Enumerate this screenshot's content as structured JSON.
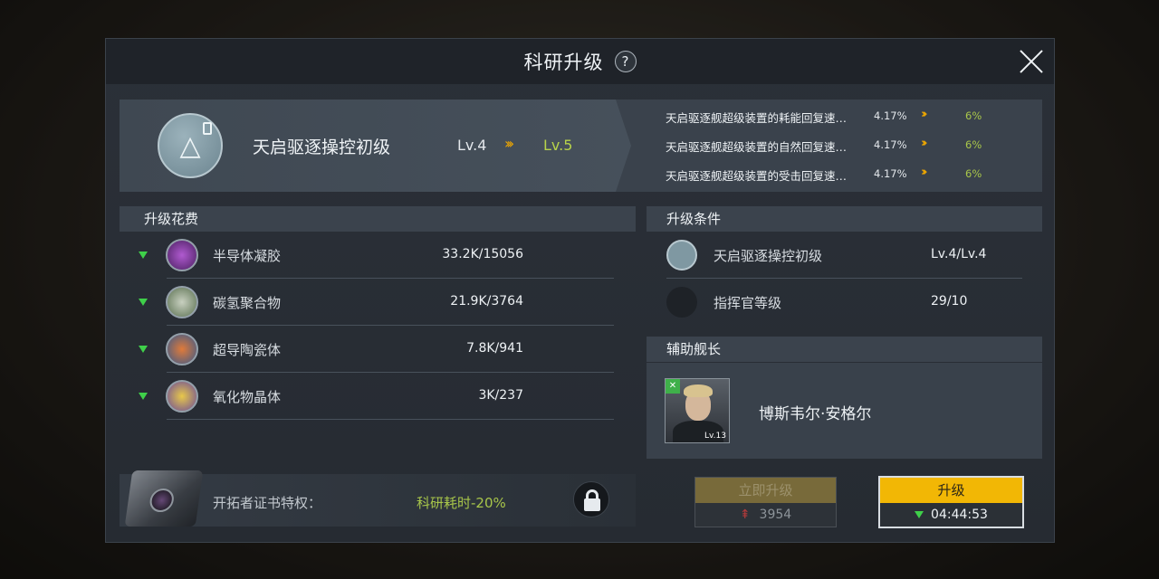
{
  "dialog": {
    "title": "科研升级",
    "help_symbol": "?"
  },
  "tech": {
    "name": "天启驱逐操控初级",
    "level_from": "Lv.4",
    "level_arrow": "›››",
    "level_to": "Lv.5",
    "effects": [
      {
        "name": "天启驱逐舰超级装置的耗能回复速…",
        "from": "4.17%",
        "arrow": "›››",
        "to": "6%"
      },
      {
        "name": "天启驱逐舰超级装置的自然回复速…",
        "from": "4.17%",
        "arrow": "›››",
        "to": "6%"
      },
      {
        "name": "天启驱逐舰超级装置的受击回复速…",
        "from": "4.17%",
        "arrow": "›››",
        "to": "6%"
      }
    ]
  },
  "cost": {
    "header": "升级花费",
    "items": [
      {
        "name": "半导体凝胶",
        "value": "33.2K/15056",
        "icon": "gel-resource-icon",
        "color": "#8a3aa8"
      },
      {
        "name": "碳氢聚合物",
        "value": "21.9K/3764",
        "icon": "polymer-resource-icon",
        "color": "#6f8a5a"
      },
      {
        "name": "超导陶瓷体",
        "value": "7.8K/941",
        "icon": "ceramic-resource-icon",
        "color": "#c0642a"
      },
      {
        "name": "氧化物晶体",
        "value": "3K/237",
        "icon": "crystal-resource-icon",
        "color": "#c8a23a"
      }
    ]
  },
  "conditions": {
    "header": "升级条件",
    "items": [
      {
        "name": "天启驱逐操控初级",
        "value": "Lv.4/Lv.4"
      },
      {
        "name": "指挥官等级",
        "value": "29/10"
      }
    ]
  },
  "captain": {
    "header": "辅助舰长",
    "name": "博斯韦尔·安格尔",
    "level": "Lv.13"
  },
  "privilege": {
    "label": "开拓者证书特权：",
    "value": "科研耗时-20%"
  },
  "buttons": {
    "instant_label": "立即升级",
    "instant_cost": "3954",
    "upgrade_label": "升级",
    "upgrade_time": "04:44:53"
  }
}
